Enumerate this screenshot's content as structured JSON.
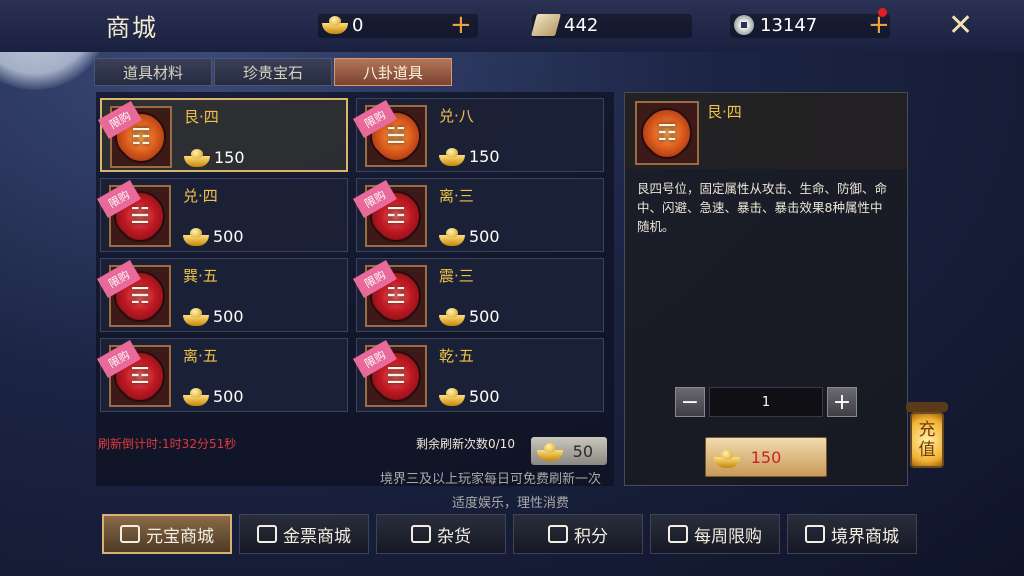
{
  "header": {
    "title": "商城",
    "ingot_amount": "0",
    "ticket_amount": "442",
    "copper_amount": "13147"
  },
  "tabs": [
    {
      "label": "道具材料",
      "active": false
    },
    {
      "label": "珍贵宝石",
      "active": false
    },
    {
      "label": "八卦道具",
      "active": true
    }
  ],
  "items": [
    {
      "name": "艮·四",
      "price": "150",
      "badge": "限购",
      "glyph": "☶",
      "color": "orange",
      "selected": true
    },
    {
      "name": "兑·八",
      "price": "150",
      "badge": "限购",
      "glyph": "☱",
      "color": "orange",
      "selected": false
    },
    {
      "name": "兑·四",
      "price": "500",
      "badge": "限购",
      "glyph": "☱",
      "color": "red",
      "selected": false
    },
    {
      "name": "离·三",
      "price": "500",
      "badge": "限购",
      "glyph": "☲",
      "color": "red",
      "selected": false
    },
    {
      "name": "巽·五",
      "price": "500",
      "badge": "限购",
      "glyph": "☴",
      "color": "red",
      "selected": false
    },
    {
      "name": "震·三",
      "price": "500",
      "badge": "限购",
      "glyph": "☳",
      "color": "red",
      "selected": false
    },
    {
      "name": "离·五",
      "price": "500",
      "badge": "限购",
      "glyph": "☲",
      "color": "red",
      "selected": false
    },
    {
      "name": "乾·五",
      "price": "500",
      "badge": "限购",
      "glyph": "☰",
      "color": "red",
      "selected": false
    }
  ],
  "refresh": {
    "countdown": "刷新倒计时:1时32分51秒",
    "remaining": "剩余刷新次数0/10",
    "cost": "50",
    "note": "境界三及以上玩家每日可免费刷新一次"
  },
  "moderation": "适度娱乐，理性消费",
  "detail": {
    "name": "艮·四",
    "glyph": "☶",
    "description": "艮四号位，固定属性从攻击、生命、防御、命中、闪避、急速、暴击、暴击效果8种属性中随机。",
    "quantity": "1",
    "minus": "−",
    "plus": "+",
    "buy_price": "150"
  },
  "lantern": {
    "line1": "充",
    "line2": "值"
  },
  "bottom_nav": [
    {
      "label": "元宝商城",
      "active": true
    },
    {
      "label": "金票商城",
      "active": false
    },
    {
      "label": "杂货",
      "active": false
    },
    {
      "label": "积分",
      "active": false
    },
    {
      "label": "每周限购",
      "active": false
    },
    {
      "label": "境界商城",
      "active": false
    }
  ],
  "colors": {
    "accent_gold": "#f0c24a",
    "price_red": "#c8222a",
    "badge_pink": "#e86a98",
    "countdown_red": "#e03a3a"
  }
}
